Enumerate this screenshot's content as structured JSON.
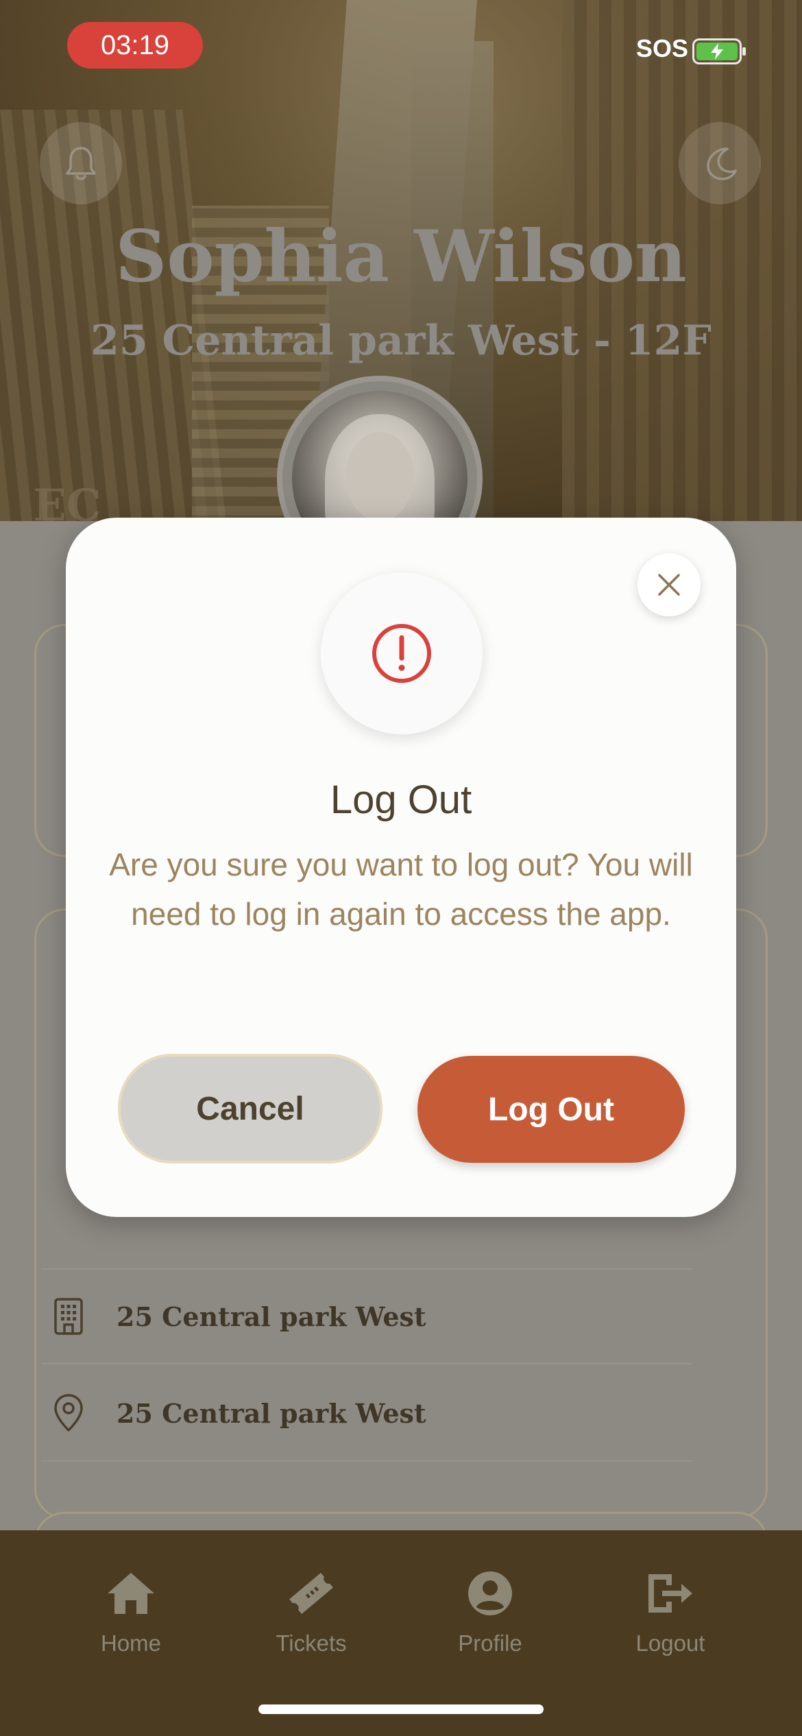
{
  "status_bar": {
    "time": "03:19",
    "sos": "SOS"
  },
  "header": {
    "name": "Sophia Wilson",
    "address": "25 Central park West - 12F",
    "faded_text": "EC",
    "bell_icon": "bell-icon",
    "theme_icon": "moon-icon",
    "avatar": "avatar-photo"
  },
  "details": {
    "building": "25 Central park West",
    "location": "25 Central park West",
    "building_icon": "building-icon",
    "location_icon": "map-pin-icon"
  },
  "modal": {
    "title": "Log Out",
    "message": "Are you sure you want to log out? You will need to log in again to access the app.",
    "cancel_label": "Cancel",
    "confirm_label": "Log Out",
    "alert_icon": "alert-circle-icon",
    "close_icon": "close-icon",
    "accent_color": "#c65c37",
    "alert_color": "#d9413b"
  },
  "tabbar": {
    "items": [
      {
        "label": "Home",
        "icon": "home-icon"
      },
      {
        "label": "Tickets",
        "icon": "ticket-icon"
      },
      {
        "label": "Profile",
        "icon": "user-icon"
      },
      {
        "label": "Logout",
        "icon": "logout-icon"
      }
    ],
    "background": "#4a3b21"
  }
}
